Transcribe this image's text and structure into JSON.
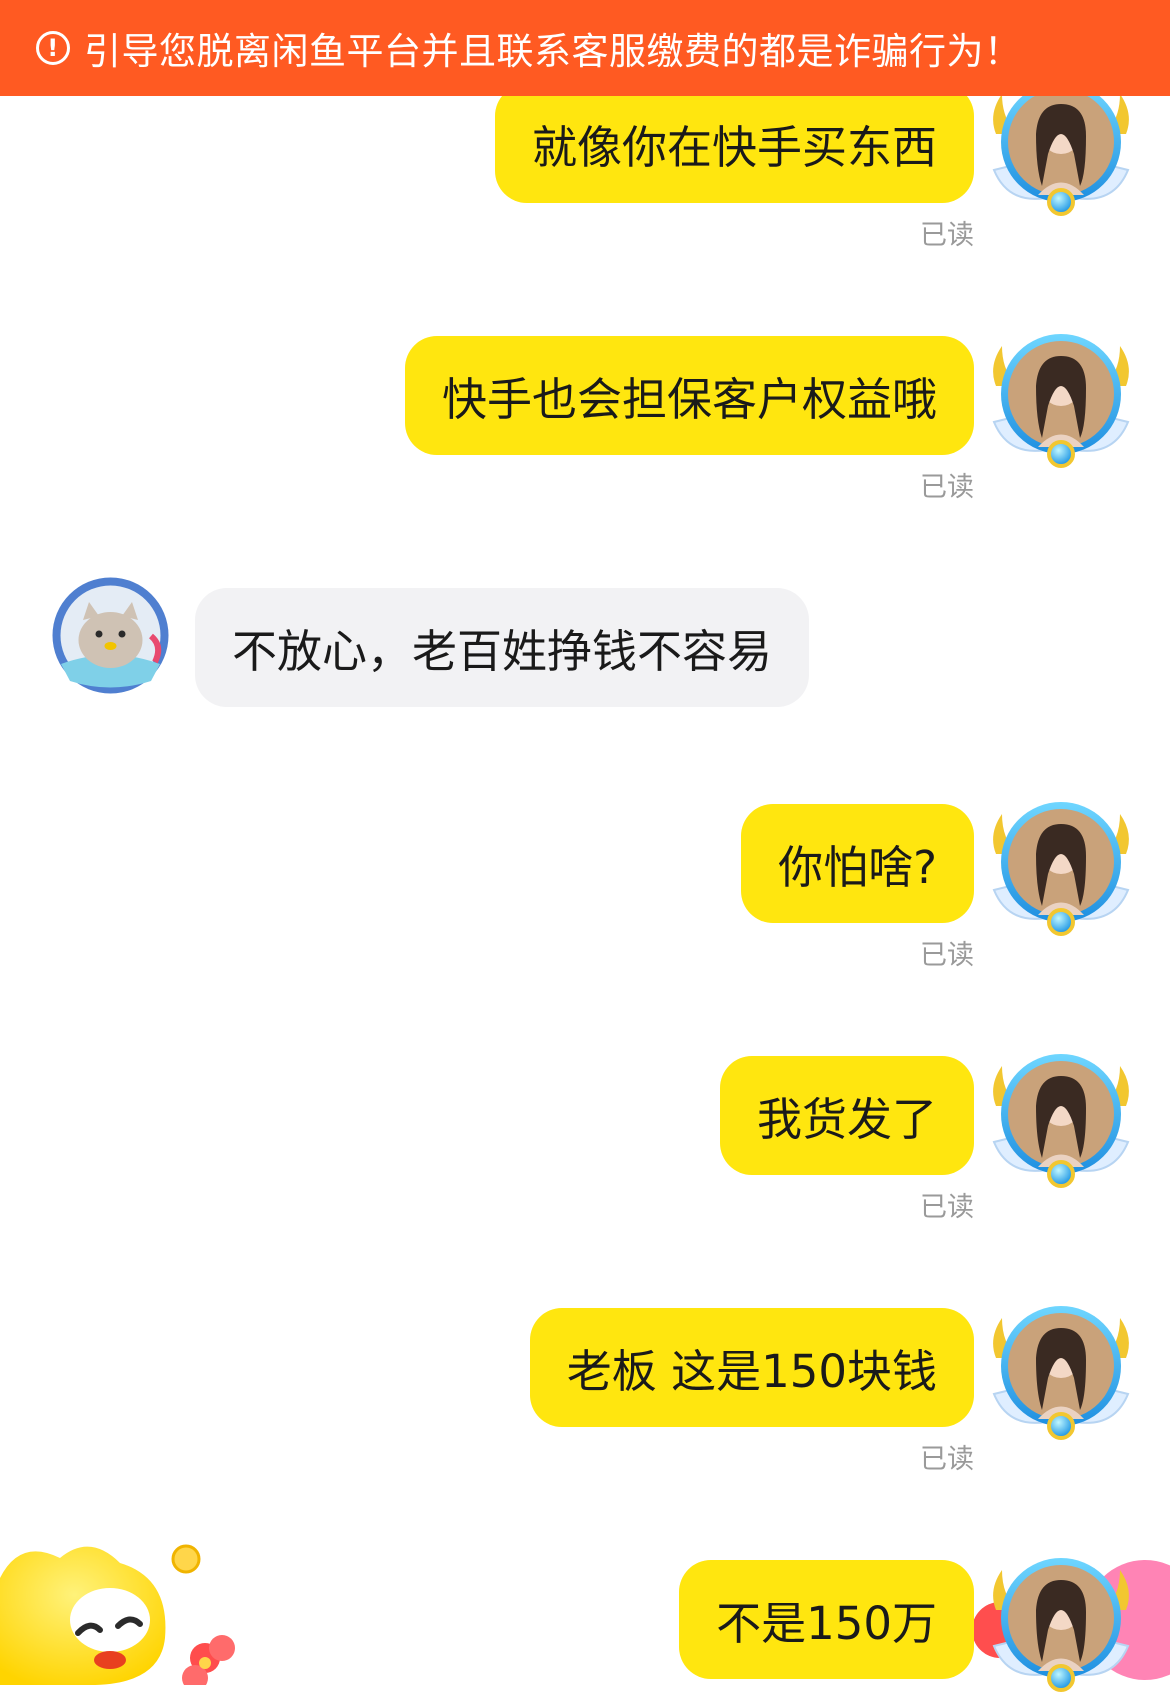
{
  "banner": {
    "icon": "exclamation-circle-icon",
    "text": "引导您脱离闲鱼平台并且联系客服缴费的都是诈骗行为！"
  },
  "colors": {
    "banner_bg": "#ff5a22",
    "my_bubble": "#ffe60f",
    "their_bubble": "#f2f2f4",
    "read_text": "#9a9a9a"
  },
  "messages": [
    {
      "side": "mine",
      "text": "就像你在快手买东西",
      "status": "已读"
    },
    {
      "side": "mine",
      "text": "快手也会担保客户权益哦",
      "status": "已读"
    },
    {
      "side": "theirs",
      "text": "不放心，老百姓挣钱不容易"
    },
    {
      "side": "mine",
      "text": "你怕啥?",
      "status": "已读"
    },
    {
      "side": "mine",
      "text": "我货发了",
      "status": "已读"
    },
    {
      "side": "mine",
      "text": "老板 这是150块钱",
      "status": "已读"
    },
    {
      "side": "mine",
      "text": "不是150万"
    }
  ]
}
